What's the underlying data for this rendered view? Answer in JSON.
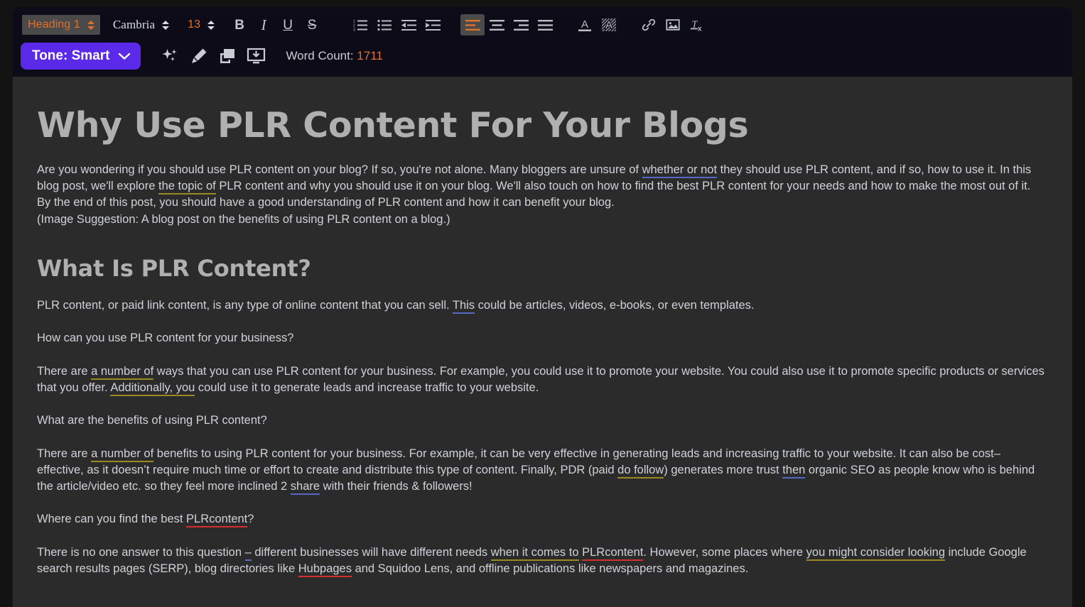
{
  "toolbar": {
    "style_select": {
      "value": "Heading 1",
      "name": "paragraph-style-select"
    },
    "font_select": {
      "value": "Cambria",
      "name": "font-family-select"
    },
    "size_select": {
      "value": "13",
      "name": "font-size-select"
    },
    "format_buttons": [
      {
        "icon": "bold-icon",
        "label": "B"
      },
      {
        "icon": "italic-icon",
        "label": "I"
      },
      {
        "icon": "underline-icon",
        "label": "U"
      },
      {
        "icon": "strikethrough-icon",
        "label": "S"
      }
    ],
    "list_buttons": [
      {
        "icon": "ordered-list-icon"
      },
      {
        "icon": "bullet-list-icon"
      },
      {
        "icon": "outdent-icon"
      },
      {
        "icon": "indent-icon"
      }
    ],
    "align_buttons": [
      {
        "icon": "align-left-icon",
        "active": true
      },
      {
        "icon": "align-center-icon",
        "active": false
      },
      {
        "icon": "align-right-icon",
        "active": false
      },
      {
        "icon": "align-justify-icon",
        "active": false
      }
    ],
    "color_buttons": [
      {
        "icon": "text-color-icon"
      },
      {
        "icon": "highlight-color-icon"
      }
    ],
    "insert_buttons": [
      {
        "icon": "link-icon"
      },
      {
        "icon": "image-icon"
      },
      {
        "icon": "clear-formatting-icon"
      }
    ],
    "tone": {
      "label": "Tone:  Smart",
      "chevron": "chevron-down-icon",
      "color": "#5b2ae8"
    },
    "ai_buttons": [
      {
        "icon": "sparkle-icon"
      },
      {
        "icon": "pen-icon"
      },
      {
        "icon": "copy-icon"
      },
      {
        "icon": "save-to-device-icon"
      }
    ],
    "word_count": {
      "label": "Word Count: ",
      "value": "1711",
      "accent": "#e0702a"
    }
  },
  "document": {
    "title": "Why Use PLR Content For Your Blogs",
    "p1": {
      "a": "Are you wondering if you should use PLR content on your blog? If so, you're not alone. Many bloggers are unsure of ",
      "s1": "whether or not",
      "b": " they should use PLR content, and if so, how to use it. In this blog post, we'll explore ",
      "s2": "the topic of",
      "c": " PLR content and why you should use it on your blog. We'll also touch on how to find the best PLR content for your needs and how to make the most out of it. By the end of this post, you should have a good understanding of PLR content and how it can benefit your blog."
    },
    "p2": "(Image Suggestion: A blog post on the benefits of using PLR content on a blog.)",
    "h2": "What Is PLR Content?",
    "p3": {
      "a": "PLR content, or paid link content, is any type of online content that you can sell. ",
      "s1": "This",
      "b": " could be articles, videos, e-books, or even templates."
    },
    "p4": "How can you use PLR content for your business?",
    "p5": {
      "a": "There are ",
      "s1": "a number of",
      "b": " ways that you can use PLR content for your business. For example, you could use it to promote your website. You could also use it to promote specific products or services that you offer. ",
      "s2": "Additionally, you",
      "c": " could use it to generate leads and increase traffic to your website."
    },
    "p6": "What are the benefits of using PLR content?",
    "p7": {
      "a": "There are ",
      "s1": "a number of",
      "b": " benefits to using PLR content for your business. For example, it can be very effective in generating leads and increasing traffic to your website. It can also be cost–effective, as it doesn’t require much time or effort to create and distribute this type of content. Finally, PDR (paid ",
      "s2": "do follow",
      "c": ") generates more trust ",
      "s3": "then",
      "d": " organic SEO as people know who is behind the article/video etc. so they feel more inclined 2 ",
      "s4": "share",
      "e": " with their friends & followers!"
    },
    "p8": {
      "a": "Where can you find the best ",
      "s1": "PLRcontent",
      "b": "?"
    },
    "p9": {
      "a": "There is no one answer to this question ",
      "s1": "–",
      "b": " different businesses will have different needs ",
      "s2": "when it comes to",
      "c": " ",
      "s3": "PLRcontent",
      "d": ". However, some places where ",
      "s4": "you might consider looking",
      "e": " include Google search results pages (SERP), blog directories like ",
      "s5": "Hubpages",
      "f": " and Squidoo Lens, and offline publications like newspapers and magazines."
    }
  },
  "colors": {
    "toolbar_bg": "#0d0b17",
    "doc_bg": "#2b2b2b",
    "accent_orange": "#e0702a",
    "tone_purple": "#5b2ae8",
    "suggestion_gold": "#9a8a23",
    "suggestion_blue": "#5568c4",
    "suggestion_red": "#d32f2f"
  }
}
